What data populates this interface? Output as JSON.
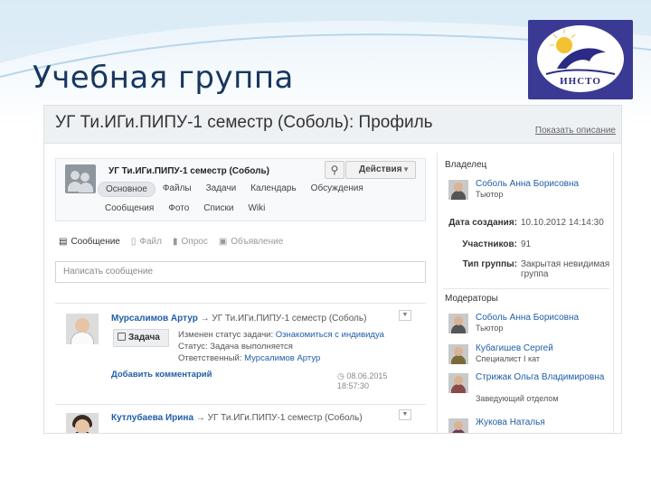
{
  "slide": {
    "title": "Учебная группа",
    "logo_text": "ИНСТО",
    "colors": {
      "title": "#17375e",
      "logo_bg": "#3a3a94",
      "link": "#1f5ea8"
    }
  },
  "page": {
    "title": "УГ Ти.ИГи.ПИПУ-1 семестр (Соболь): Профиль",
    "show_description": "Показать описание"
  },
  "group": {
    "name": "УГ Ти.ИГи.ПИПУ-1 семестр (Соболь)",
    "action_label": "Действия",
    "nav_row1": [
      "Основное",
      "Файлы",
      "Задачи",
      "Календарь",
      "Обсуждения"
    ],
    "nav_row2": [
      "Сообщения",
      "Фото",
      "Списки",
      "Wiki"
    ],
    "active_nav": "Основное"
  },
  "composer": {
    "tabs": [
      {
        "label": "Сообщение",
        "icon": "message-icon"
      },
      {
        "label": "Файл",
        "icon": "file-icon"
      },
      {
        "label": "Опрос",
        "icon": "poll-icon"
      },
      {
        "label": "Объявление",
        "icon": "announcement-icon"
      }
    ],
    "placeholder": "Написать сообщение"
  },
  "posts": [
    {
      "author": "Мурсалимов Артур",
      "arrow": "→",
      "target": "УГ Ти.ИГи.ПИПУ-1 семестр (Соболь)",
      "badge": "Задача",
      "line1_prefix": "Изменен статус задачи:",
      "line1_link": "Ознакомиться с индивидуа",
      "line2": "Статус: Задача выполняется",
      "line3_prefix": "Ответственный:",
      "line3_link": "Мурсалимов Артур",
      "add_comment": "Добавить комментарий",
      "time": "08.06.2015 18:57:30"
    },
    {
      "author": "Кутлубаева Ирина",
      "arrow": "→",
      "target": "УГ Ти.ИГи.ПИПУ-1 семестр (Соболь)"
    }
  ],
  "sidebar": {
    "owner_label": "Владелец",
    "owner": {
      "name": "Соболь Анна Борисовна",
      "role": "Тьютор"
    },
    "created_label": "Дата создания:",
    "created_value": "10.10.2012 14:14:30",
    "members_label": "Участников:",
    "members_value": "91",
    "type_label": "Тип группы:",
    "type_value_1": "Закрытая невидимая",
    "type_value_2": "группа",
    "moderators_label": "Модераторы",
    "moderators": [
      {
        "name": "Соболь Анна Борисовна",
        "role": "Тьютор"
      },
      {
        "name": "Кубагишев Сергей",
        "role": "Специалист I кат"
      },
      {
        "name": "Стрижак Ольга Владимировна",
        "role": "Заведующий отделом"
      },
      {
        "name": "Жукова Наталья",
        "role": ""
      }
    ]
  }
}
